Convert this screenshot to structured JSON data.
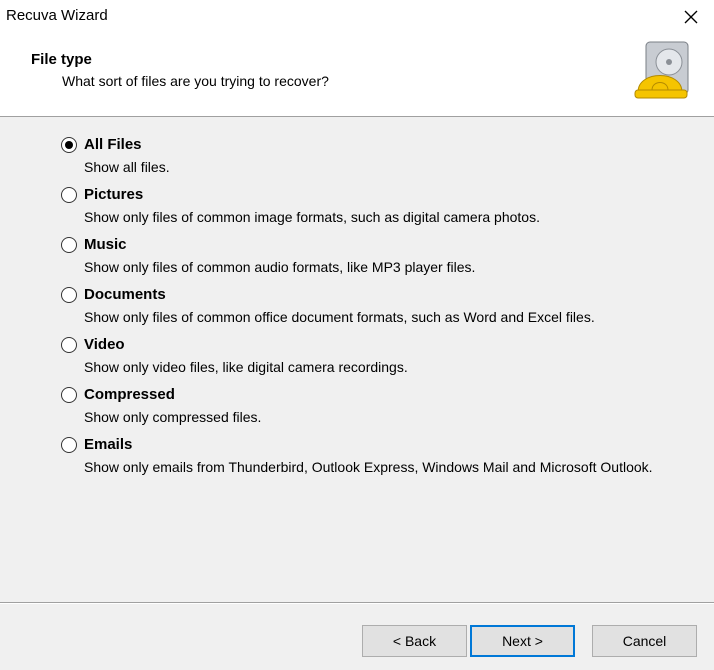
{
  "window": {
    "title": "Recuva Wizard",
    "close_icon": "close-icon"
  },
  "header": {
    "title": "File type",
    "subtitle": "What sort of files are you trying to recover?",
    "logo_icon": "recuva-hard-hat-drive-icon"
  },
  "options": [
    {
      "label": "All Files",
      "description": "Show all files.",
      "selected": true
    },
    {
      "label": "Pictures",
      "description": "Show only files of common image formats, such as digital camera photos.",
      "selected": false
    },
    {
      "label": "Music",
      "description": "Show only files of common audio formats, like MP3 player files.",
      "selected": false
    },
    {
      "label": "Documents",
      "description": "Show only files of common office document formats, such as Word and Excel files.",
      "selected": false
    },
    {
      "label": "Video",
      "description": "Show only video files, like digital camera recordings.",
      "selected": false
    },
    {
      "label": "Compressed",
      "description": "Show only compressed files.",
      "selected": false
    },
    {
      "label": "Emails",
      "description": "Show only emails from Thunderbird, Outlook Express, Windows Mail and Microsoft Outlook.",
      "selected": false
    }
  ],
  "buttons": {
    "back": "< Back",
    "next": "Next >",
    "cancel": "Cancel"
  },
  "colors": {
    "accent": "#0078d7",
    "logo_yellow": "#f5c400"
  }
}
